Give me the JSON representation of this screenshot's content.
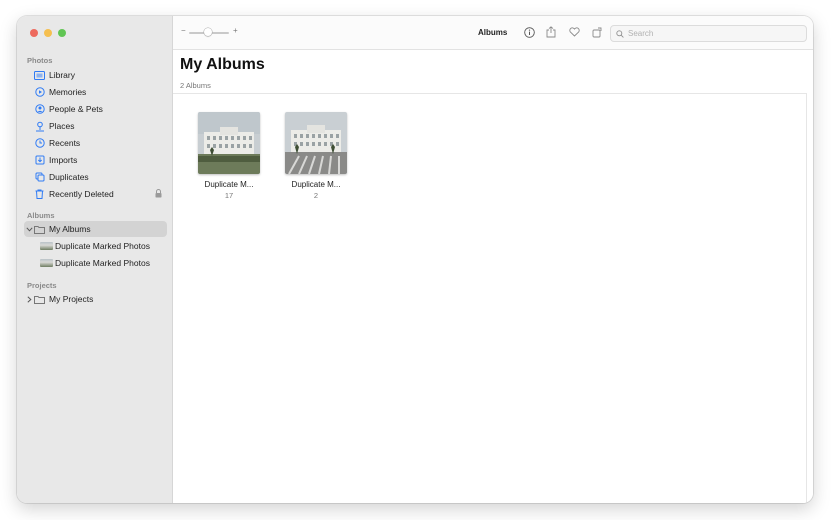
{
  "sidebar": {
    "photos_section": "Photos",
    "photos_items": [
      {
        "label": "Library",
        "icon": "library-icon"
      },
      {
        "label": "Memories",
        "icon": "memories-icon"
      },
      {
        "label": "People & Pets",
        "icon": "people-icon"
      },
      {
        "label": "Places",
        "icon": "places-icon"
      },
      {
        "label": "Recents",
        "icon": "recents-icon"
      },
      {
        "label": "Imports",
        "icon": "imports-icon"
      },
      {
        "label": "Duplicates",
        "icon": "duplicates-icon"
      },
      {
        "label": "Recently Deleted",
        "icon": "trash-icon"
      }
    ],
    "albums_section": "Albums",
    "my_albums": "My Albums",
    "album_children": [
      {
        "label": "Duplicate Marked Photos"
      },
      {
        "label": "Duplicate Marked Photos"
      }
    ],
    "projects_section": "Projects",
    "my_projects": "My Projects"
  },
  "toolbar": {
    "zoom_minus": "−",
    "zoom_plus": "+",
    "title": "Albums",
    "search_placeholder": "Search",
    "zoom_level_fraction": 0.35
  },
  "main": {
    "title": "My Albums",
    "count": "2 Albums",
    "albums": [
      {
        "name": "Duplicate M...",
        "count": "17"
      },
      {
        "name": "Duplicate M...",
        "count": "2"
      }
    ]
  },
  "colors": {
    "accent": "#2f7bf5",
    "close": "#ed6a5e",
    "minimize": "#f5bf4f",
    "maximize": "#61c554"
  }
}
